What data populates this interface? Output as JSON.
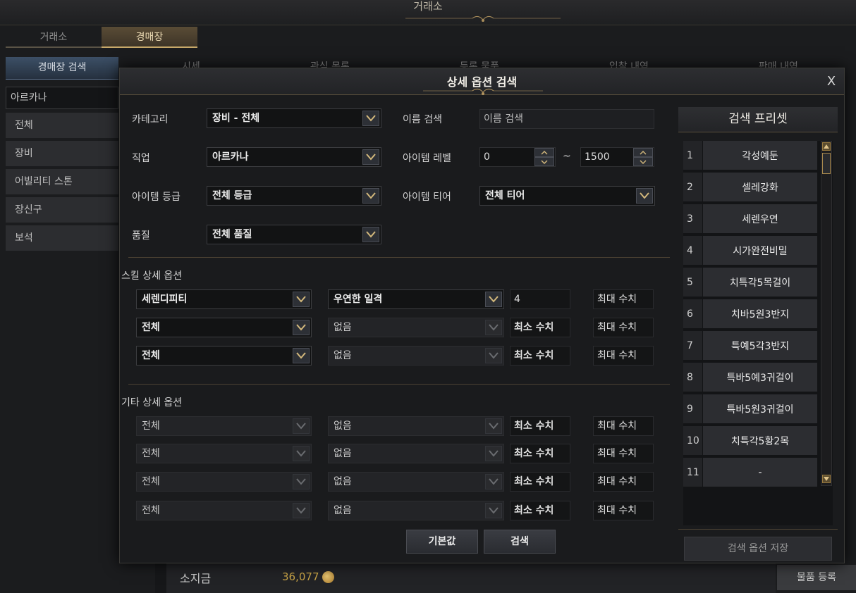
{
  "app": {
    "title": "거래소",
    "main_tabs": [
      "거래소",
      "경매장"
    ],
    "left_panel": {
      "header": "경매장 검색",
      "class_select": "아르카나",
      "categories": [
        "전체",
        "장비",
        "어빌리티 스톤",
        "장신구",
        "보석"
      ]
    },
    "sub_tabs": [
      "시세",
      "관심 목록",
      "등록 물품",
      "입찰 내역",
      "판매 내역"
    ],
    "footer": {
      "gold_label": "소지금",
      "gold_amount": "36,077",
      "register_button": "물품 등록"
    }
  },
  "dialog": {
    "title": "상세 옵션 검색",
    "close": "X",
    "fields": {
      "category_label": "카테고리",
      "category_value": "장비 - 전체",
      "name_search_label": "이름 검색",
      "name_search_placeholder": "이름 검색",
      "class_label": "직업",
      "class_value": "아르카나",
      "item_level_label": "아이템 레벨",
      "item_level_min": "0",
      "item_level_sep": "~",
      "item_level_max": "1500",
      "grade_label": "아이템 등급",
      "grade_value": "전체 등급",
      "tier_label": "아이템 티어",
      "tier_value": "전체 티어",
      "quality_label": "품질",
      "quality_value": "전체 품질"
    },
    "skill_section": {
      "title": "스킬 상세 옵션",
      "rows": [
        {
          "option": "세렌디피티",
          "sub": "우연한 일격",
          "min": "4",
          "max": "최대 수치"
        },
        {
          "option": "전체",
          "sub": "없음",
          "min": "최소 수치",
          "max": "최대 수치"
        },
        {
          "option": "전체",
          "sub": "없음",
          "min": "최소 수치",
          "max": "최대 수치"
        }
      ]
    },
    "etc_section": {
      "title": "기타 상세 옵션",
      "rows": [
        {
          "option": "전체",
          "sub": "없음",
          "min": "최소 수치",
          "max": "최대 수치"
        },
        {
          "option": "전체",
          "sub": "없음",
          "min": "최소 수치",
          "max": "최대 수치"
        },
        {
          "option": "전체",
          "sub": "없음",
          "min": "최소 수치",
          "max": "최대 수치"
        },
        {
          "option": "전체",
          "sub": "없음",
          "min": "최소 수치",
          "max": "최대 수치"
        }
      ]
    },
    "buttons": {
      "default": "기본값",
      "search": "검색"
    },
    "presets": {
      "title": "검색 프리셋",
      "items": [
        {
          "num": "1",
          "name": "각성예둔"
        },
        {
          "num": "2",
          "name": "셀레강화"
        },
        {
          "num": "3",
          "name": "세렌우연"
        },
        {
          "num": "4",
          "name": "시가완전비밀"
        },
        {
          "num": "5",
          "name": "치특각5목걸이"
        },
        {
          "num": "6",
          "name": "치바5원3반지"
        },
        {
          "num": "7",
          "name": "특예5각3반지"
        },
        {
          "num": "8",
          "name": "특바5예3귀걸이"
        },
        {
          "num": "9",
          "name": "특바5원3귀걸이"
        },
        {
          "num": "10",
          "name": "치특각5황2목"
        },
        {
          "num": "11",
          "name": "-"
        }
      ],
      "save_button": "검색 옵션 저장"
    }
  }
}
